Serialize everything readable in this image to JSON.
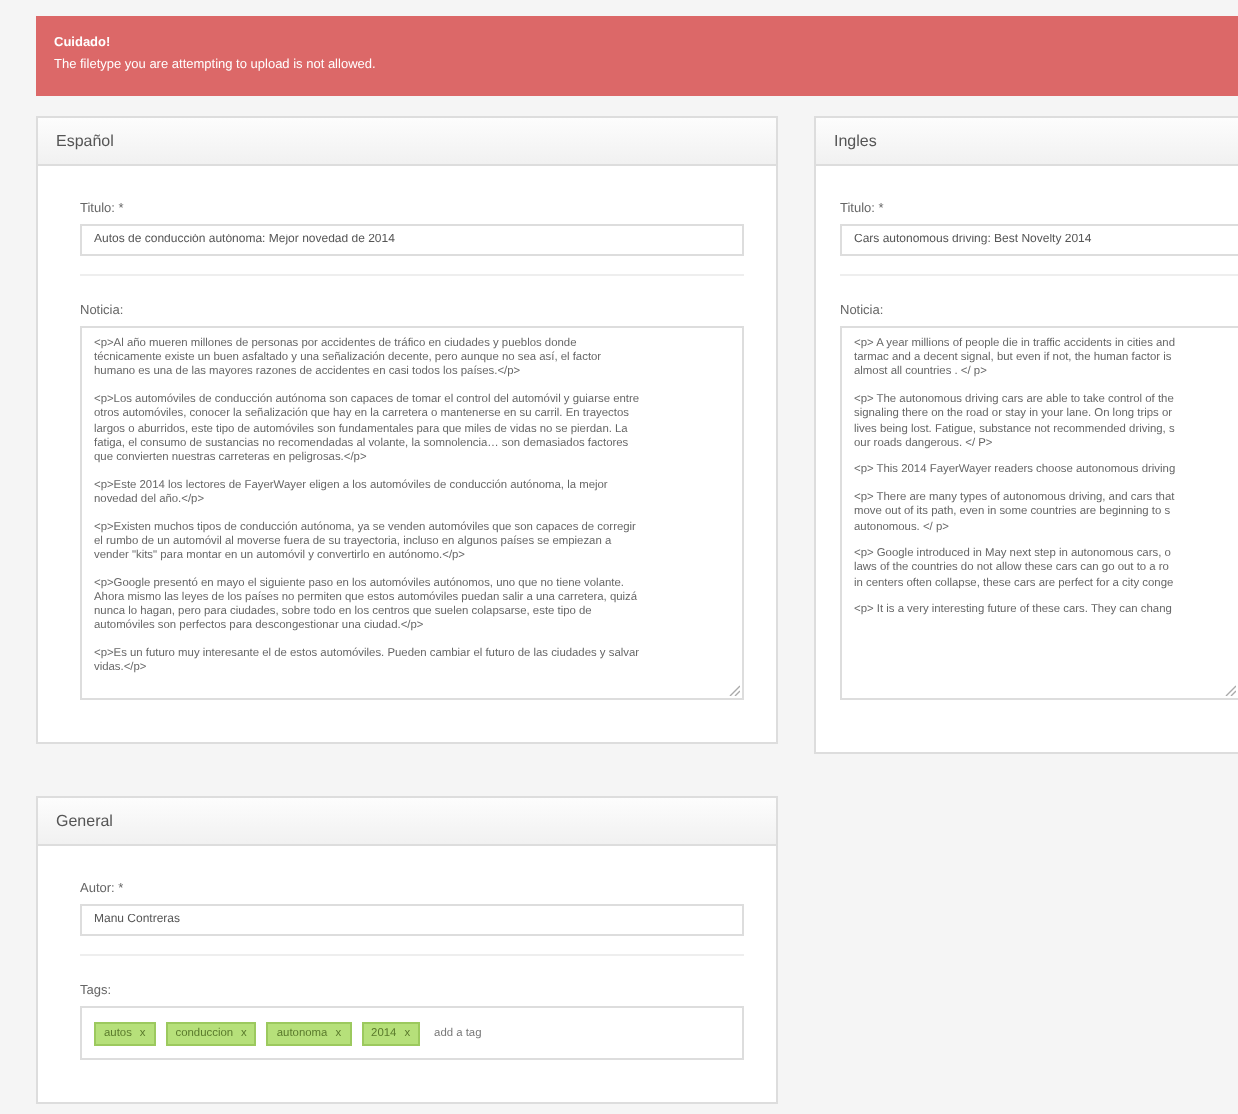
{
  "alert": {
    "title": "Cuidado!",
    "message": "The filetype you are attempting to upload is not allowed."
  },
  "panels": [
    {
      "heading": "Español",
      "fields": [
        {
          "kind": "input",
          "label": "Titulo: *",
          "value": "Autos de conducción autónoma: Mejor novedad de 2014"
        },
        {
          "kind": "textarea",
          "label": "Noticia:",
          "paragraphs": [
            [
              "<p>Al año mueren millones de personas por accidentes de tráfico en ciudades y pueblos donde",
              "técnicamente existe un buen asfaltado y una señalización decente, pero aunque no sea así, el factor",
              "humano es una de las mayores razones de accidentes en casi todos los países.</p>"
            ],
            [
              "<p>Los automóviles de conducción autónoma son capaces de tomar el control del automóvil y guiarse entre",
              "otros automóviles, conocer la señalización que hay en la carretera o mantenerse en su carril. En trayectos",
              "largos o aburridos, este tipo de automóviles son fundamentales para que miles de vidas no se pierdan. La",
              "fatiga, el consumo de sustancias no recomendadas al volante, la somnolencia… son demasiados factores",
              "que convierten nuestras carreteras en peligrosas.</p>"
            ],
            [
              "<p>Este 2014 los lectores de FayerWayer eligen a los automóviles de conducción autónoma, la mejor",
              "novedad del año.</p>"
            ],
            [
              "<p>Existen muchos tipos de conducción autónoma, ya se venden automóviles que son capaces de corregir",
              "el rumbo de un automóvil al moverse fuera de su trayectoria, incluso en algunos países se empiezan a",
              "vender \"kits\" para montar en un automóvil y convertirlo en autónomo.</p>"
            ],
            [
              "<p>Google presentó en mayo el siguiente paso en los automóviles autónomos, uno que no tiene volante.",
              "Ahora mismo las leyes de los países no permiten que estos automóviles puedan salir a una carretera, quizá",
              "nunca lo hagan, pero para ciudades, sobre todo en los centros que suelen colapsarse, este tipo de",
              "automóviles son perfectos para descongestionar una ciudad.</p>"
            ],
            [
              "<p>Es un futuro muy interesante el de estos automóviles. Pueden cambiar el futuro de las ciudades y salvar",
              "vidas.</p>"
            ]
          ]
        }
      ]
    },
    {
      "heading": "Ingles",
      "fields": [
        {
          "kind": "input",
          "label": "Titulo: *",
          "value": "Cars autonomous driving: Best Novelty 2014"
        },
        {
          "kind": "textarea",
          "label": "Noticia:",
          "paragraphs": [
            [
              "<p> A year millions of people die in traffic accidents in cities and",
              "tarmac and a decent signal, but even if not, the human factor is",
              "almost all countries . </ p>"
            ],
            [
              "<p> The autonomous driving cars are able to take control of the",
              "signaling there on the road or stay in your lane. On long trips or",
              "lives being lost. Fatigue, substance not recommended driving, s",
              "our roads dangerous. </ P>"
            ],
            [
              "<p> This 2014 FayerWayer readers choose autonomous driving"
            ],
            [
              "<p> There are many types of autonomous driving, and cars that",
              "move out of its path, even in some countries are beginning to s",
              "autonomous. </ p>"
            ],
            [
              "<p> Google introduced in May next step in autonomous cars, o",
              "laws of the countries do not allow these cars can go out to a ro",
              "in centers often collapse, these cars are perfect for a city conge"
            ],
            [
              "<p> It is a very interesting future of these cars. They can chang"
            ]
          ]
        }
      ]
    }
  ],
  "general": {
    "heading": "General",
    "fields": [
      {
        "kind": "input",
        "label": "Autor: *",
        "value": "Manu Contreras"
      },
      {
        "kind": "tags",
        "label": "Tags:",
        "placeholder": "add a tag",
        "tags": [
          {
            "label": "autos",
            "remove": "x"
          },
          {
            "label": "conduccion",
            "remove": "x"
          },
          {
            "label": "autonoma",
            "remove": "x"
          },
          {
            "label": "2014",
            "remove": "x"
          }
        ]
      }
    ]
  }
}
